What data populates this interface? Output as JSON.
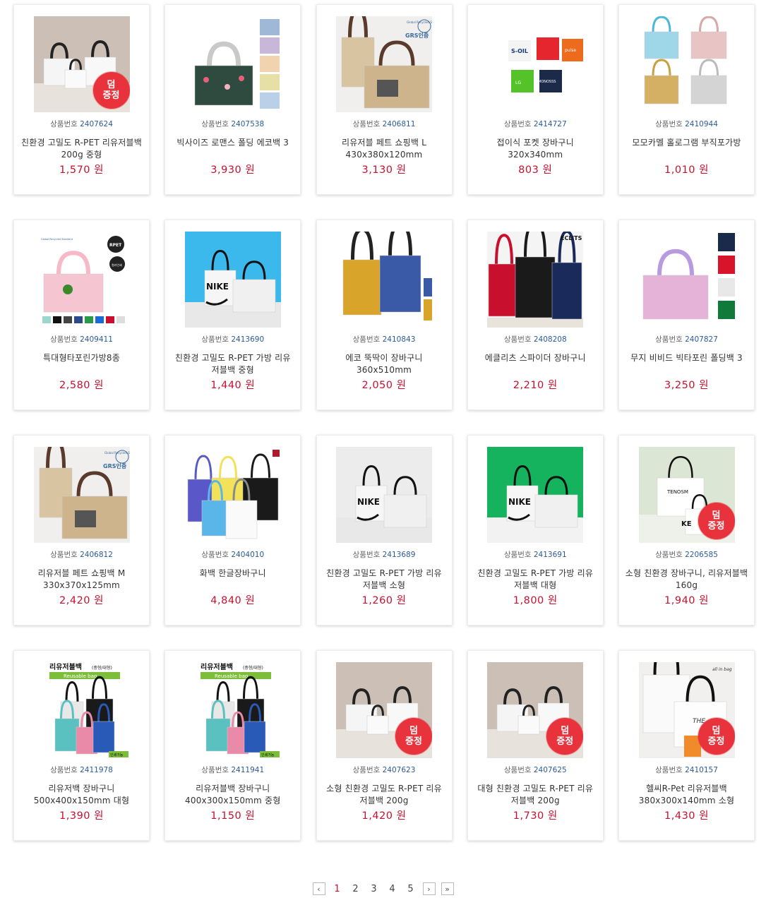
{
  "labels": {
    "code_prefix": "상품번호",
    "currency": "원",
    "badge_line1": "덤",
    "badge_line2": "증정"
  },
  "products": [
    {
      "code": "2407624",
      "name": "친환경 고밀도 R-PET 리유저블백 200g 중형",
      "price": "1,570",
      "badge": true,
      "img": "white-bags"
    },
    {
      "code": "2407538",
      "name": "빅사이즈 로맨스 폴딩 에코백 3",
      "price": "3,930",
      "badge": false,
      "img": "floral-bag"
    },
    {
      "code": "2406811",
      "name": "리유저블 페트 쇼핑백 L 430x380x120mm",
      "price": "3,130",
      "badge": false,
      "img": "kraft-bags"
    },
    {
      "code": "2414727",
      "name": "접이식 포켓 장바구니 320x340mm",
      "price": "803",
      "badge": false,
      "img": "pocket-bags"
    },
    {
      "code": "2410944",
      "name": "모모카멜 홀로그램 부직포가방",
      "price": "1,010",
      "badge": false,
      "img": "hologram-bags"
    },
    {
      "code": "2409411",
      "name": "특대형타포린가방8종",
      "price": "2,580",
      "badge": false,
      "img": "pink-tarp"
    },
    {
      "code": "2413690",
      "name": "친환경 고밀도 R-PET 가방 리유저블백 중형",
      "price": "1,440",
      "badge": false,
      "img": "blue-bags"
    },
    {
      "code": "2410843",
      "name": "에코 뚝딱이 장바구니 360x510mm",
      "price": "2,050",
      "badge": false,
      "img": "printed-eco"
    },
    {
      "code": "2408208",
      "name": "에클리츠 스파이더 장바구니",
      "price": "2,210",
      "badge": false,
      "img": "spider-bags"
    },
    {
      "code": "2407827",
      "name": "무지 비비드 빅타포린 폴딩백 3",
      "price": "3,250",
      "badge": false,
      "img": "vivid-tarp"
    },
    {
      "code": "2406812",
      "name": "리유저블 페트 쇼핑백 M 330x370x125mm",
      "price": "2,420",
      "badge": false,
      "img": "kraft-bags"
    },
    {
      "code": "2404010",
      "name": "화백 한글장바구니",
      "price": "4,840",
      "badge": false,
      "img": "hangul-bags"
    },
    {
      "code": "2413689",
      "name": "친환경 고밀도 R-PET 가방 리유저블백 소형",
      "price": "1,260",
      "badge": false,
      "img": "grey-bags"
    },
    {
      "code": "2413691",
      "name": "친환경 고밀도 R-PET 가방 리유저블백 대형",
      "price": "1,800",
      "badge": false,
      "img": "green-bags"
    },
    {
      "code": "2206585",
      "name": "소형 친환경 장바구니, 리유저블백 160g",
      "price": "1,940",
      "badge": true,
      "img": "mint-bags"
    },
    {
      "code": "2411978",
      "name": "리유저백 장바구니 500x400x150mm 대형",
      "price": "1,390",
      "badge": false,
      "img": "reusable-bags"
    },
    {
      "code": "2411941",
      "name": "리유저블백 장바구니 400x300x150mm 중형",
      "price": "1,150",
      "badge": false,
      "img": "reusable-bags"
    },
    {
      "code": "2407623",
      "name": "소형 친환경 고밀도 R-PET 리유저블백 200g",
      "price": "1,420",
      "badge": true,
      "img": "white-bags"
    },
    {
      "code": "2407625",
      "name": "대형 친환경 고밀도 R-PET 리유저블백 200g",
      "price": "1,730",
      "badge": true,
      "img": "white-bags"
    },
    {
      "code": "2410157",
      "name": "헬씨R-Pet 리유저블백 380x300x140mm 소형",
      "price": "1,430",
      "badge": true,
      "img": "studio-bags"
    }
  ],
  "image_text": {
    "kraft-bags": [
      "GRS인증",
      "Global Recycled Standard"
    ],
    "pocket-bags": [
      "S-OIL",
      "LG",
      "MONOSSS",
      "pulse"
    ],
    "pink-tarp": [
      "RPET",
      "컬러인쇄",
      "Global Recycled Standard"
    ],
    "spider-bags": [
      "ECLiTS"
    ],
    "blue-bags": [
      "NIKE"
    ],
    "grey-bags": [
      "NIKE"
    ],
    "green-bags": [
      "NIKE"
    ],
    "mint-bags": [
      "TENOSM",
      "KE"
    ],
    "reusable-bags": [
      "리유저블백",
      "(중형/대형)",
      "Reusable bag",
      "인쇄가능"
    ],
    "studio-bags": [
      "all in bag",
      "THE"
    ]
  },
  "pagination": {
    "prev_icon": "chevron-left-icon",
    "pages": [
      "1",
      "2",
      "3",
      "4",
      "5"
    ],
    "current": "1",
    "next_icon": "chevron-right-icon",
    "last_icon": "double-chevron-right-icon"
  }
}
